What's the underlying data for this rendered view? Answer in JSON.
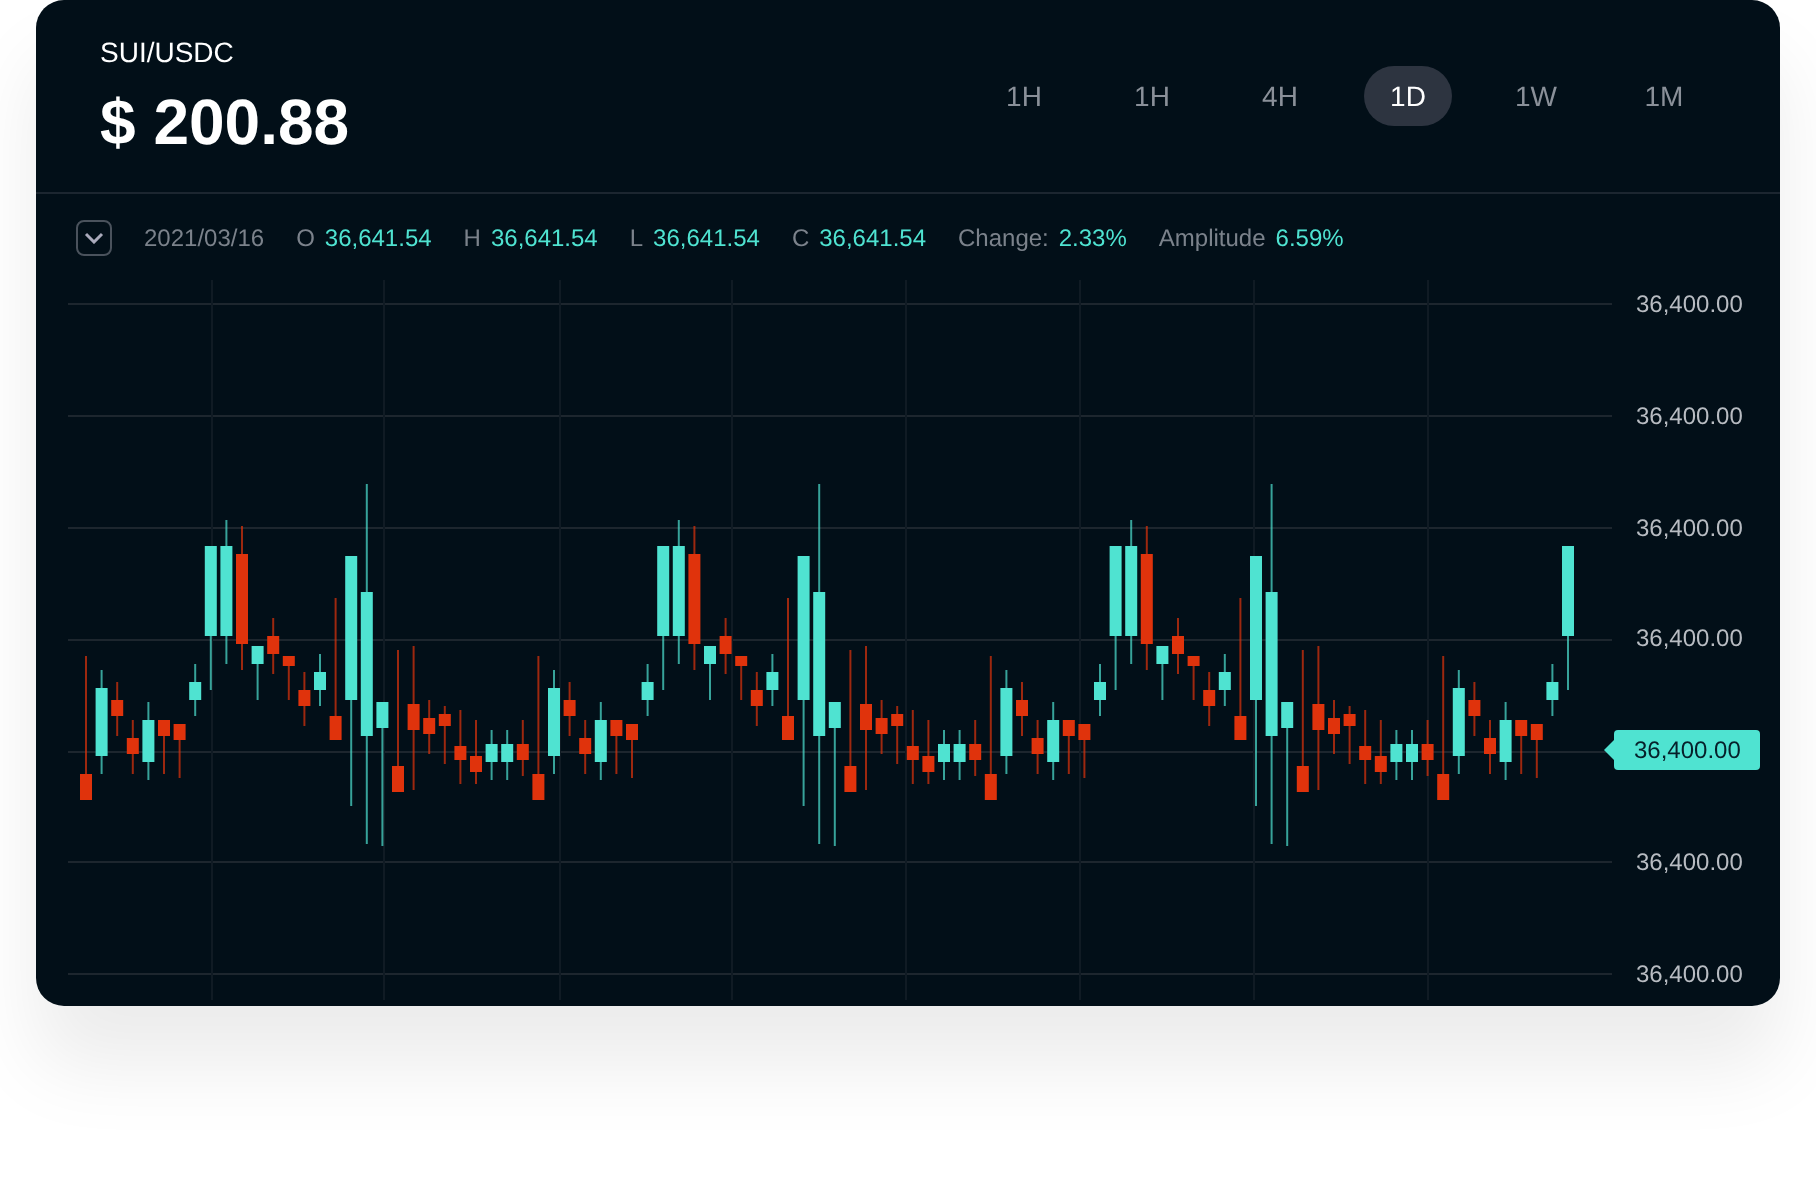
{
  "pair": "SUI/USDC",
  "price": "$ 200.88",
  "timeframes": [
    {
      "label": "1H",
      "selected": false
    },
    {
      "label": "1H",
      "selected": false
    },
    {
      "label": "4H",
      "selected": false
    },
    {
      "label": "1D",
      "selected": true
    },
    {
      "label": "1W",
      "selected": false
    },
    {
      "label": "1M",
      "selected": false
    }
  ],
  "ohlc": {
    "date": "2021/03/16",
    "fields": [
      {
        "label": "O",
        "value": "36,641.54"
      },
      {
        "label": "H",
        "value": "36,641.54"
      },
      {
        "label": "L",
        "value": "36,641.54"
      },
      {
        "label": "C",
        "value": "36,641.54"
      },
      {
        "label": "Change:",
        "value": "2.33%"
      },
      {
        "label": "Amplitude",
        "value": "6.59%"
      }
    ]
  },
  "y_labels": [
    {
      "kind": "tick",
      "text": "36,400.00"
    },
    {
      "kind": "tick",
      "text": "36,400.00"
    },
    {
      "kind": "tick",
      "text": "36,400.00"
    },
    {
      "kind": "tick",
      "text": "36,400.00"
    },
    {
      "kind": "current",
      "text": "36,400.00"
    },
    {
      "kind": "tick",
      "text": "36,400.00"
    },
    {
      "kind": "tick",
      "text": "36,400.00"
    }
  ]
}
